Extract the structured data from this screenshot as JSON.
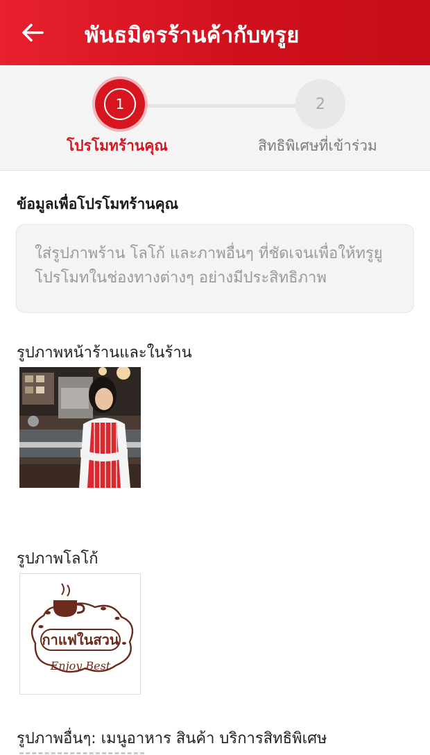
{
  "appbar": {
    "title": "พันธมิตรร้านค้ากับทรูย",
    "back_icon": "arrow-left-icon"
  },
  "stepper": {
    "steps": [
      {
        "number": "1",
        "label": "โปรโมทร้านคุณ",
        "state": "active"
      },
      {
        "number": "2",
        "label": "สิทธิพิเศษที่เข้าร่วม",
        "state": "inactive"
      }
    ],
    "active_color": "#d7151f"
  },
  "content": {
    "section_title": "ข้อมูลเพื่อโปรโมทร้านคุณ",
    "info_text": "ใส่รูปภาพร้าน โลโก้ และภาพอื่นๆ ที่ชัดเจนเพื่อให้ทรูยูโปรโมทในช่องทางต่างๆ อย่างมีประสิทธิภาพ",
    "store_photos_label": "รูปภาพหน้าร้านและในร้าน",
    "logo_label": "รูปภาพโลโก้",
    "logo_text": "กาแฟในสวน",
    "logo_tagline": "Enjoy Best",
    "other_photos_label": "รูปภาพอื่นๆ: เมนูอาหาร สินค้า บริการสิทธิพิเศษ"
  }
}
